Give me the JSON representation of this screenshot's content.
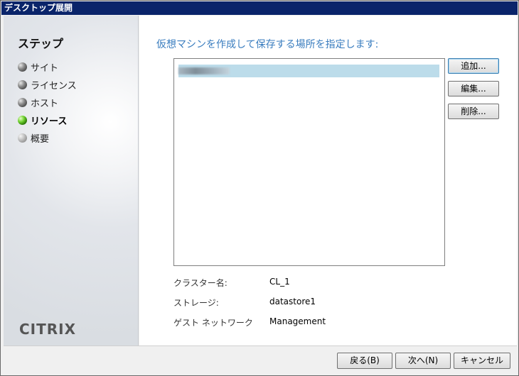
{
  "window": {
    "title": "デスクトップ展開"
  },
  "sidebar": {
    "title": "ステップ",
    "steps": [
      {
        "label": "サイト",
        "state": "done"
      },
      {
        "label": "ライセンス",
        "state": "done"
      },
      {
        "label": "ホスト",
        "state": "done"
      },
      {
        "label": "リソース",
        "state": "current"
      },
      {
        "label": "概要",
        "state": "pending"
      }
    ],
    "logo": "CITRIX"
  },
  "main": {
    "heading": "仮想マシンを作成して保存する場所を指定します:",
    "list": {
      "selected_item": "(blurred)"
    },
    "side_buttons": {
      "add": "追加...",
      "edit": "編集...",
      "delete": "削除..."
    },
    "details": [
      {
        "label": "クラスター名:",
        "value": "CL_1"
      },
      {
        "label": "ストレージ:",
        "value": "datastore1"
      },
      {
        "label": "ゲスト ネットワーク",
        "value": "Management"
      }
    ]
  },
  "footer": {
    "back": "戻る(B)",
    "next": "次へ(N)",
    "cancel": "キャンセル"
  },
  "colors": {
    "title_bar": "#0a246a",
    "heading": "#3a7dbf",
    "selection": "#bcdcea",
    "active_step": "#6fd12f"
  }
}
